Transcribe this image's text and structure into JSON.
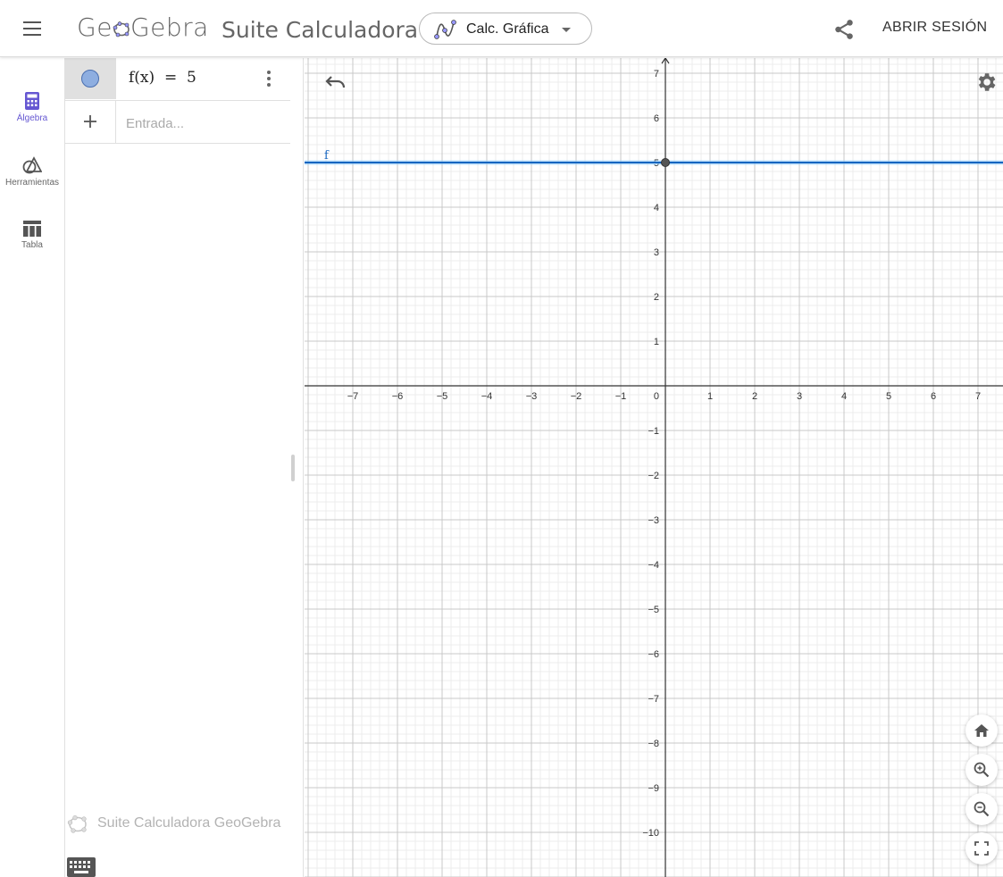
{
  "header": {
    "logo_pre": "Ge",
    "logo_post": "Gebra",
    "title": "Suite Calculadora",
    "app_switch_label": "Calc. Gráfica",
    "login_label": "ABRIR SESIÓN"
  },
  "nav": {
    "items": [
      {
        "label": "Álgebra",
        "icon": "calculator-icon",
        "active": true
      },
      {
        "label": "Herramientas",
        "icon": "shapes-icon",
        "active": false
      },
      {
        "label": "Tabla",
        "icon": "table-icon",
        "active": false
      }
    ]
  },
  "algebra": {
    "rows": [
      {
        "formula": "f(x)  =  5"
      }
    ],
    "input_placeholder": "Entrada...",
    "watermark": "Suite Calculadora GeoGebra"
  },
  "graph": {
    "x_ticks": [
      -7,
      -6,
      -5,
      -4,
      -3,
      -2,
      -1,
      1,
      2,
      3,
      4,
      5,
      6,
      7
    ],
    "y_ticks": [
      7,
      6,
      5,
      4,
      3,
      2,
      1,
      -1,
      -2,
      -3,
      -4,
      -5,
      -6,
      -7,
      -8,
      -9,
      -10
    ],
    "origin_label": "0",
    "function": {
      "name": "f",
      "value": 5,
      "color": "#1565c0"
    },
    "point": {
      "x": 0,
      "y": 5
    }
  },
  "colors": {
    "accent": "#6557d2",
    "function_line": "#1565c0"
  }
}
